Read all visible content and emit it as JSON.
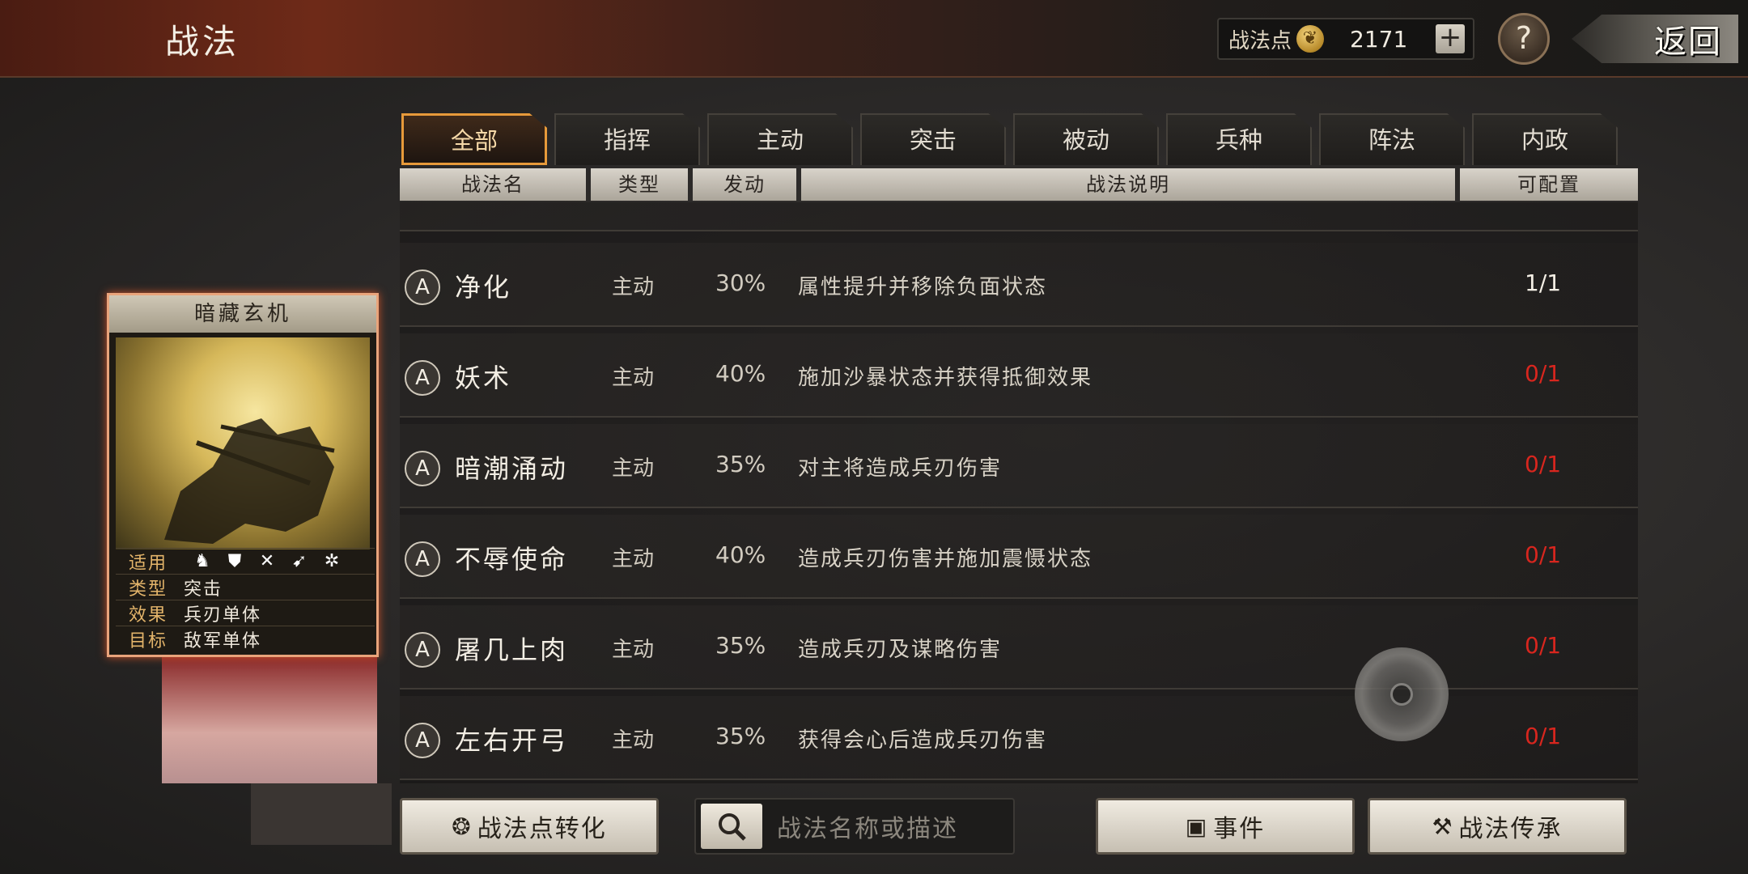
{
  "header": {
    "title": "战法",
    "points_label": "战法点",
    "points_value": "2171",
    "plus_label": "+",
    "help_label": "?",
    "back_label": "返回"
  },
  "tabs": [
    {
      "label": "全部",
      "active": true
    },
    {
      "label": "指挥"
    },
    {
      "label": "主动"
    },
    {
      "label": "突击"
    },
    {
      "label": "被动"
    },
    {
      "label": "兵种"
    },
    {
      "label": "阵法"
    },
    {
      "label": "内政"
    }
  ],
  "columns": {
    "name": "战法名",
    "type": "类型",
    "rate": "发动",
    "desc": "战法说明",
    "config": "可配置"
  },
  "rows": [
    {
      "grade": "A",
      "name": "净化",
      "type": "主动",
      "rate": "30%",
      "desc": "属性提升并移除负面状态",
      "count": "1/1"
    },
    {
      "grade": "A",
      "name": "妖术",
      "type": "主动",
      "rate": "40%",
      "desc": "施加沙暴状态并获得抵御效果",
      "count": "0/1"
    },
    {
      "grade": "A",
      "name": "暗潮涌动",
      "type": "主动",
      "rate": "35%",
      "desc": "对主将造成兵刃伤害",
      "count": "0/1"
    },
    {
      "grade": "A",
      "name": "不辱使命",
      "type": "主动",
      "rate": "40%",
      "desc": "造成兵刃伤害并施加震慑状态",
      "count": "0/1"
    },
    {
      "grade": "A",
      "name": "屠几上肉",
      "type": "主动",
      "rate": "35%",
      "desc": "造成兵刃及谋略伤害",
      "count": "0/1"
    },
    {
      "grade": "A",
      "name": "左右开弓",
      "type": "主动",
      "rate": "35%",
      "desc": "获得会心后造成兵刃伤害",
      "count": "0/1"
    }
  ],
  "card": {
    "title": "暗藏玄机",
    "apply_label": "适用",
    "type_label": "类型",
    "type_value": "突击",
    "effect_label": "效果",
    "effect_value": "兵刃单体",
    "target_label": "目标",
    "target_value": "敌军单体",
    "unit_icons": [
      "cavalry-icon",
      "shield-icon",
      "bow-icon",
      "spear-icon",
      "chariot-icon"
    ]
  },
  "footer": {
    "convert_label": "战法点转化",
    "search_placeholder": "战法名称或描述",
    "events_label": "事件",
    "inherit_label": "战法传承"
  },
  "colors": {
    "accent": "#e79a3a",
    "unavailable": "#d8261e"
  }
}
